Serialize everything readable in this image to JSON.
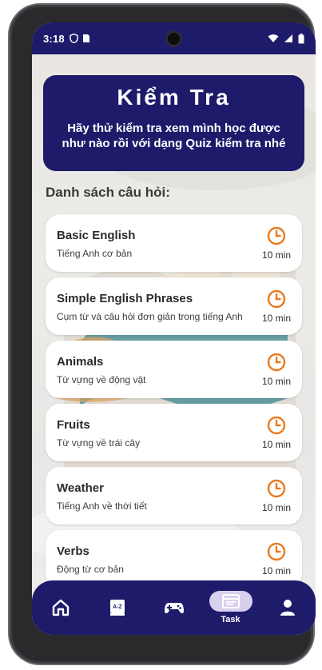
{
  "status_bar": {
    "time": "3:18"
  },
  "header": {
    "title": "Kiểm Tra",
    "subtitle": "Hãy thử kiểm tra xem mình học được như nào rồi với dạng Quiz kiểm tra nhé"
  },
  "section_title": "Danh sách câu hỏi:",
  "quizzes": [
    {
      "title": "Basic English",
      "subtitle": "Tiếng Anh cơ bản",
      "duration": "10 min"
    },
    {
      "title": "Simple English Phrases",
      "subtitle": "Cụm từ và câu hỏi đơn giản trong tiếng Anh",
      "duration": "10 min"
    },
    {
      "title": "Animals",
      "subtitle": "Từ vựng về động vật",
      "duration": "10 min"
    },
    {
      "title": "Fruits",
      "subtitle": "Từ vựng về trái cây",
      "duration": "10 min"
    },
    {
      "title": "Weather",
      "subtitle": "Tiếng Anh về thời tiết",
      "duration": "10 min"
    },
    {
      "title": "Verbs",
      "subtitle": "Động từ cơ bản",
      "duration": "10 min"
    }
  ],
  "bottom_nav": {
    "items": [
      {
        "icon": "home-icon"
      },
      {
        "icon": "dictionary-icon"
      },
      {
        "icon": "gamepad-icon"
      },
      {
        "icon": "task-icon",
        "label": "Task",
        "active": true
      },
      {
        "icon": "profile-icon"
      }
    ]
  },
  "colors": {
    "primary": "#1e1b6b",
    "accent": "#e8791e",
    "active_pill": "#d9d0ee"
  }
}
